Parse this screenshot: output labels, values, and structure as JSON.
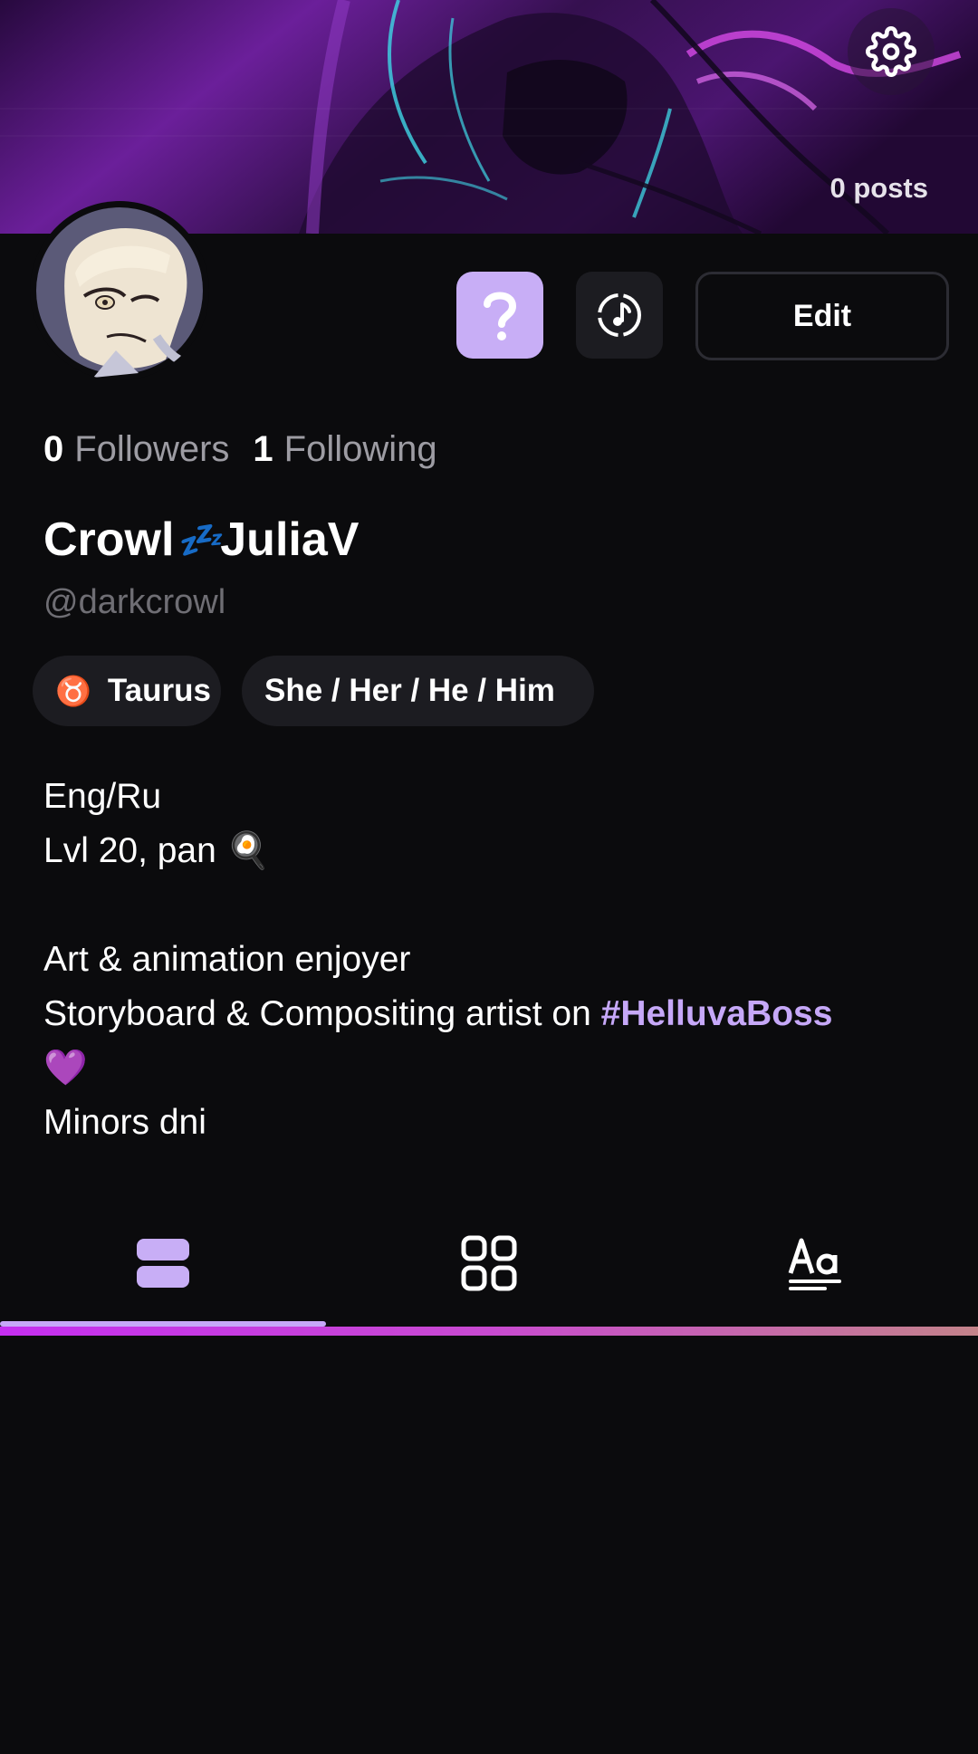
{
  "header": {
    "post_count": "0 posts",
    "settings_icon": "gear-icon"
  },
  "profile": {
    "followers_count": "0",
    "followers_label": "Followers",
    "following_count": "1",
    "following_label": "Following",
    "name_part1": "Crowl",
    "name_emoji": "💤",
    "name_part2": "JuliaV",
    "handle": "@darkcrowl",
    "edit_label": "Edit",
    "help_icon": "question-icon",
    "music_icon": "music-note-icon"
  },
  "tags": {
    "zodiac_symbol": "♉",
    "zodiac": "Taurus",
    "pronouns": "She / Her / He / Him"
  },
  "bio": {
    "line1": "Eng/Ru",
    "line2_text": "Lvl 20, pan",
    "line2_emoji": "🍳",
    "line3": "",
    "line4": "Art & animation enjoyer",
    "line5_text": "Storyboard & Compositing artist on ",
    "line5_hashtag": "#HelluvaBoss",
    "line6_emoji": "💜",
    "line7": "Minors dni"
  },
  "tabs": {
    "items": [
      {
        "icon": "list-view-icon",
        "active": true
      },
      {
        "icon": "grid-view-icon",
        "active": false
      },
      {
        "icon": "text-icon",
        "active": false
      }
    ]
  },
  "colors": {
    "accent": "#c8aef6",
    "background": "#0b0b0d",
    "chip": "#1c1c21",
    "underline_gradient_start": "#c52ef0",
    "underline_gradient_end": "#c4838a"
  }
}
